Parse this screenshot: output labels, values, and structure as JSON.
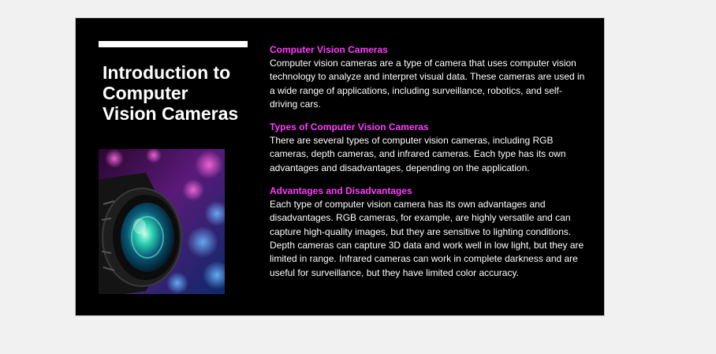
{
  "slide": {
    "title": "Introduction to\nComputer\nVision Cameras",
    "image": {
      "subject": "camera-lens-photo"
    },
    "sections": [
      {
        "heading": "Computer Vision Cameras",
        "body": "Computer vision cameras are a type of camera that uses computer vision technology to analyze and interpret visual data. These cameras are used in a wide range of applications, including surveillance, robotics, and self-driving cars."
      },
      {
        "heading": "Types of Computer Vision Cameras",
        "body": "There are several types of computer vision cameras, including RGB cameras, depth cameras, and infrared cameras. Each type has its own advantages and disadvantages, depending on the application."
      },
      {
        "heading": "Advantages and Disadvantages",
        "body": "Each type of computer vision camera has its own advantages and disadvantages. RGB cameras, for example, are highly versatile and can capture high-quality images, but they are sensitive to lighting conditions. Depth cameras can capture 3D data and work well in low light, but they are limited in range. Infrared cameras can work in complete darkness and are useful for surveillance, but they have limited color accuracy."
      }
    ]
  },
  "colors": {
    "slide_background": "#000000",
    "page_background": "#f1f1f1",
    "heading_accent": "#ff3cff",
    "text": "#ffffff"
  }
}
